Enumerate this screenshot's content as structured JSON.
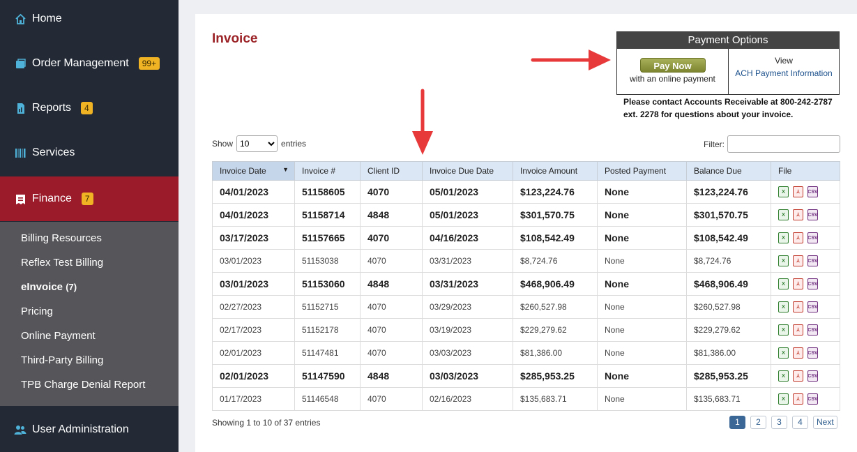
{
  "sidebar": {
    "items": [
      {
        "label": "Home",
        "icon": "home-icon"
      },
      {
        "label": "Order Management",
        "badge": "99+",
        "icon": "box-icon"
      },
      {
        "label": "Reports",
        "badge": "4",
        "icon": "report-icon"
      },
      {
        "label": "Services",
        "icon": "barcode-icon"
      },
      {
        "label": "Finance",
        "badge": "7",
        "icon": "invoice-icon"
      },
      {
        "label": "User Administration",
        "icon": "users-icon"
      }
    ],
    "finance_sub": [
      {
        "label": "Billing Resources"
      },
      {
        "label": "Reflex Test Billing"
      },
      {
        "label": "eInvoice",
        "count": "(7)"
      },
      {
        "label": "Pricing"
      },
      {
        "label": "Online Payment"
      },
      {
        "label": "Third-Party Billing"
      },
      {
        "label": "TPB Charge Denial Report"
      }
    ]
  },
  "main": {
    "title": "Invoice",
    "payment": {
      "header": "Payment Options",
      "pay_now": "Pay Now",
      "pay_sub": "with an online payment",
      "view": "View",
      "ach": "ACH Payment Information"
    },
    "contact": "Please contact Accounts Receivable at 800-242-2787 ext. 2278 for questions about your invoice.",
    "show_label": "Show",
    "show_value": "10",
    "entries_label": "entries",
    "filter_label": "Filter:",
    "columns": [
      "Invoice Date",
      "Invoice #",
      "Client ID",
      "Invoice Due Date",
      "Invoice Amount",
      "Posted Payment",
      "Balance Due",
      "File"
    ],
    "rows": [
      {
        "date": "04/01/2023",
        "num": "51158605",
        "client": "4070",
        "due": "05/01/2023",
        "amount": "$123,224.76",
        "posted": "None",
        "balance": "$123,224.76",
        "bold": true
      },
      {
        "date": "04/01/2023",
        "num": "51158714",
        "client": "4848",
        "due": "05/01/2023",
        "amount": "$301,570.75",
        "posted": "None",
        "balance": "$301,570.75",
        "bold": true
      },
      {
        "date": "03/17/2023",
        "num": "51157665",
        "client": "4070",
        "due": "04/16/2023",
        "amount": "$108,542.49",
        "posted": "None",
        "balance": "$108,542.49",
        "bold": true
      },
      {
        "date": "03/01/2023",
        "num": "51153038",
        "client": "4070",
        "due": "03/31/2023",
        "amount": "$8,724.76",
        "posted": "None",
        "balance": "$8,724.76",
        "bold": false
      },
      {
        "date": "03/01/2023",
        "num": "51153060",
        "client": "4848",
        "due": "03/31/2023",
        "amount": "$468,906.49",
        "posted": "None",
        "balance": "$468,906.49",
        "bold": true
      },
      {
        "date": "02/27/2023",
        "num": "51152715",
        "client": "4070",
        "due": "03/29/2023",
        "amount": "$260,527.98",
        "posted": "None",
        "balance": "$260,527.98",
        "bold": false
      },
      {
        "date": "02/17/2023",
        "num": "51152178",
        "client": "4070",
        "due": "03/19/2023",
        "amount": "$229,279.62",
        "posted": "None",
        "balance": "$229,279.62",
        "bold": false
      },
      {
        "date": "02/01/2023",
        "num": "51147481",
        "client": "4070",
        "due": "03/03/2023",
        "amount": "$81,386.00",
        "posted": "None",
        "balance": "$81,386.00",
        "bold": false
      },
      {
        "date": "02/01/2023",
        "num": "51147590",
        "client": "4848",
        "due": "03/03/2023",
        "amount": "$285,953.25",
        "posted": "None",
        "balance": "$285,953.25",
        "bold": true
      },
      {
        "date": "01/17/2023",
        "num": "51146548",
        "client": "4070",
        "due": "02/16/2023",
        "amount": "$135,683.71",
        "posted": "None",
        "balance": "$135,683.71",
        "bold": false
      }
    ],
    "file_icons": [
      "excel-icon",
      "pdf-icon",
      "csv-icon"
    ],
    "showing": "Showing 1 to 10 of 37 entries",
    "pages": [
      "1",
      "2",
      "3",
      "4"
    ],
    "next": "Next"
  },
  "colors": {
    "accent_red": "#9b1b2a",
    "title_red": "#9b2226",
    "sidebar_bg": "#232a36",
    "badge": "#f0b323",
    "arrow": "#e8393a"
  }
}
